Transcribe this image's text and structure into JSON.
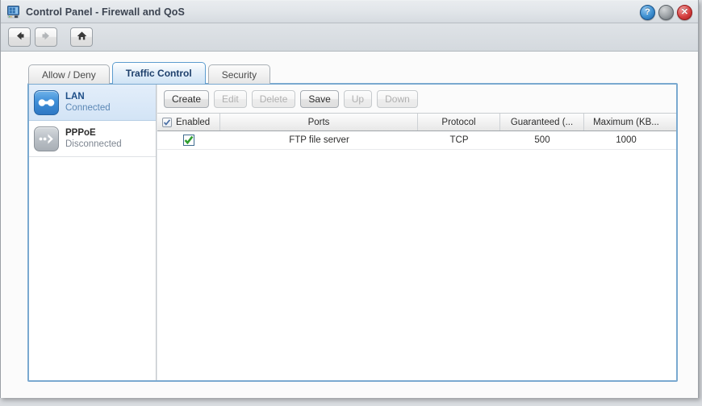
{
  "window": {
    "title": "Control Panel - Firewall and QoS",
    "icon": "control-panel-icon",
    "buttons": {
      "help": "?",
      "minimize": "",
      "close": "✕"
    }
  },
  "nav": {
    "back": "←",
    "forward": "→",
    "home": "⌂"
  },
  "tabs": [
    {
      "label": "Allow / Deny",
      "active": false
    },
    {
      "label": "Traffic Control",
      "active": true
    },
    {
      "label": "Security",
      "active": false
    }
  ],
  "sidebar": {
    "items": [
      {
        "title": "LAN",
        "status": "Connected",
        "icon": "lan-icon",
        "selected": true
      },
      {
        "title": "PPPoE",
        "status": "Disconnected",
        "icon": "pppoe-icon",
        "selected": false
      }
    ]
  },
  "toolbar": {
    "buttons": [
      {
        "label": "Create",
        "disabled": false
      },
      {
        "label": "Edit",
        "disabled": true
      },
      {
        "label": "Delete",
        "disabled": true
      },
      {
        "label": "Save",
        "disabled": false
      },
      {
        "label": "Up",
        "disabled": true
      },
      {
        "label": "Down",
        "disabled": true
      }
    ]
  },
  "grid": {
    "columns": [
      {
        "label": "Enabled"
      },
      {
        "label": "Ports"
      },
      {
        "label": "Protocol"
      },
      {
        "label": "Guaranteed (..."
      },
      {
        "label": "Maximum (KB..."
      }
    ],
    "header_checkbox_checked": true,
    "rows": [
      {
        "enabled": true,
        "ports": "FTP file server",
        "protocol": "TCP",
        "guaranteed": "500",
        "maximum": "1000"
      }
    ]
  },
  "colors": {
    "accent": "#7aa9d0",
    "active_tab_text": "#1d3f6b",
    "selected_row_bg": "#d3e4f6",
    "check_green": "#2f9e2f",
    "close_red": "#d64040",
    "help_blue": "#3d8fd0"
  }
}
